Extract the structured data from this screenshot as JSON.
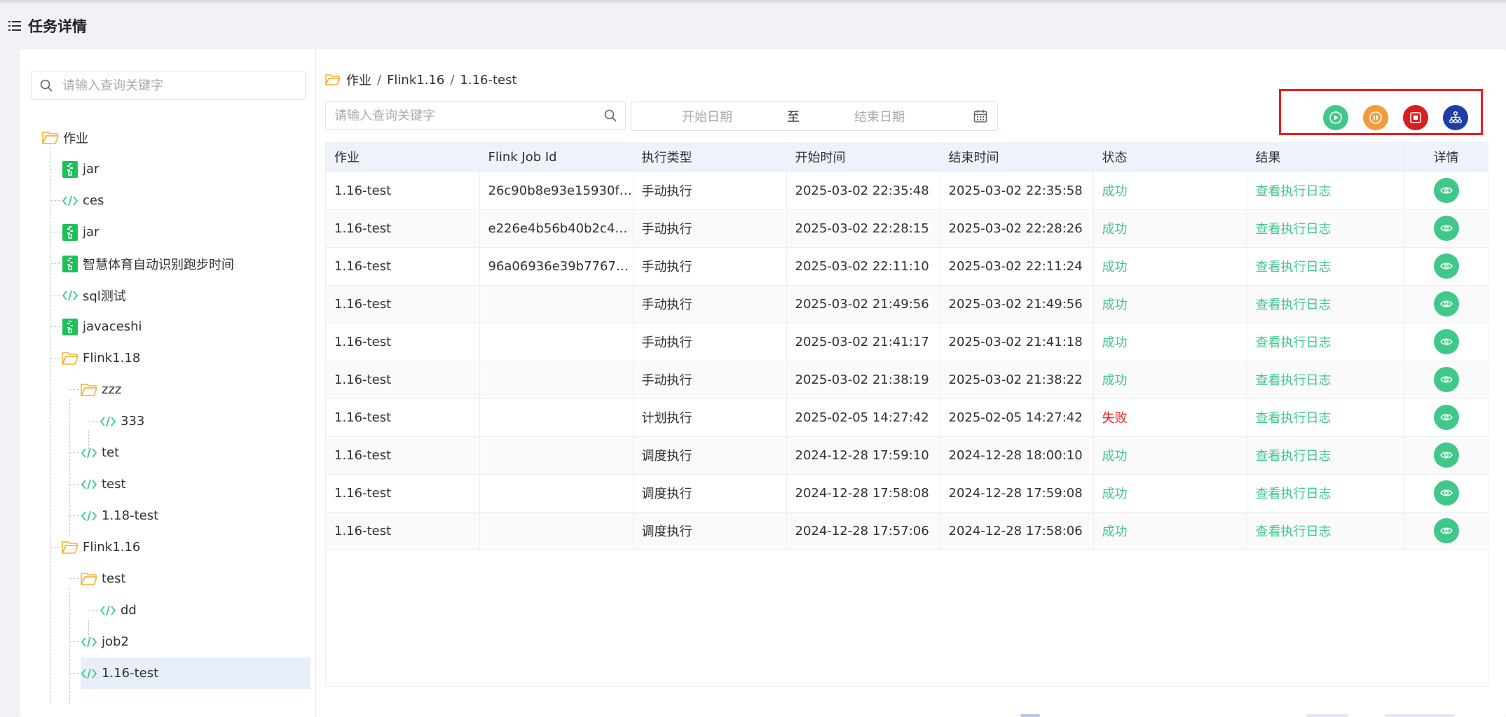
{
  "page": {
    "title": "任务详情"
  },
  "tree": {
    "search_placeholder": "请输入查询关键字",
    "root": "作业",
    "nodes": [
      {
        "label": "jar",
        "icon": "jar-icon"
      },
      {
        "label": "ces",
        "icon": "code-icon"
      },
      {
        "label": "jar",
        "icon": "jar-icon"
      },
      {
        "label": "智慧体育自动识别跑步时间",
        "icon": "jar-icon"
      },
      {
        "label": "sql测试",
        "icon": "code-icon"
      },
      {
        "label": "javaceshi",
        "icon": "jar-icon"
      },
      {
        "label": "Flink1.18",
        "icon": "folder-icon"
      },
      {
        "label": "zzz",
        "icon": "folder-icon"
      },
      {
        "label": "333",
        "icon": "code-icon"
      },
      {
        "label": "tet",
        "icon": "code-icon"
      },
      {
        "label": "test",
        "icon": "code-icon"
      },
      {
        "label": "1.18-test",
        "icon": "code-icon"
      },
      {
        "label": "Flink1.16",
        "icon": "folder-icon"
      },
      {
        "label": "test",
        "icon": "folder-icon"
      },
      {
        "label": "dd",
        "icon": "code-icon"
      },
      {
        "label": "job2",
        "icon": "code-icon"
      },
      {
        "label": "1.16-test",
        "icon": "code-icon"
      }
    ]
  },
  "breadcrumb": {
    "items": [
      "作业",
      "Flink1.16",
      "1.16-test"
    ],
    "separator": "/"
  },
  "filters": {
    "search_placeholder": "请输入查询关键字",
    "start_placeholder": "开始日期",
    "range_separator": "至",
    "end_placeholder": "结束日期"
  },
  "actions": [
    {
      "name": "run-button",
      "icon": "play-icon",
      "color": "#3fc88a"
    },
    {
      "name": "pause-button",
      "icon": "pause-icon",
      "color": "#f29b38"
    },
    {
      "name": "stop-button",
      "icon": "stop-icon",
      "color": "#d81e1e"
    },
    {
      "name": "lineage-button",
      "icon": "sitemap-icon",
      "color": "#1b3fa8"
    }
  ],
  "table": {
    "headers": [
      "作业",
      "Flink Job Id",
      "执行类型",
      "开始时间",
      "结束时间",
      "状态",
      "结果",
      "详情"
    ],
    "rows": [
      {
        "job": "1.16-test",
        "job_id": "26c90b8e93e15930fa…",
        "type": "手动执行",
        "start": "2025-03-02 22:35:48",
        "end": "2025-03-02 22:35:58",
        "status": "成功",
        "result": "查看执行日志"
      },
      {
        "job": "1.16-test",
        "job_id": "e226e4b56b40b2c46…",
        "type": "手动执行",
        "start": "2025-03-02 22:28:15",
        "end": "2025-03-02 22:28:26",
        "status": "成功",
        "result": "查看执行日志"
      },
      {
        "job": "1.16-test",
        "job_id": "96a06936e39b77677…",
        "type": "手动执行",
        "start": "2025-03-02 22:11:10",
        "end": "2025-03-02 22:11:24",
        "status": "成功",
        "result": "查看执行日志"
      },
      {
        "job": "1.16-test",
        "job_id": "",
        "type": "手动执行",
        "start": "2025-03-02 21:49:56",
        "end": "2025-03-02 21:49:56",
        "status": "成功",
        "result": "查看执行日志"
      },
      {
        "job": "1.16-test",
        "job_id": "",
        "type": "手动执行",
        "start": "2025-03-02 21:41:17",
        "end": "2025-03-02 21:41:18",
        "status": "成功",
        "result": "查看执行日志"
      },
      {
        "job": "1.16-test",
        "job_id": "",
        "type": "手动执行",
        "start": "2025-03-02 21:38:19",
        "end": "2025-03-02 21:38:22",
        "status": "成功",
        "result": "查看执行日志"
      },
      {
        "job": "1.16-test",
        "job_id": "",
        "type": "计划执行",
        "start": "2025-02-05 14:27:42",
        "end": "2025-02-05 14:27:42",
        "status": "失败",
        "result": "查看执行日志"
      },
      {
        "job": "1.16-test",
        "job_id": "",
        "type": "调度执行",
        "start": "2024-12-28 17:59:10",
        "end": "2024-12-28 18:00:10",
        "status": "成功",
        "result": "查看执行日志"
      },
      {
        "job": "1.16-test",
        "job_id": "",
        "type": "调度执行",
        "start": "2024-12-28 17:58:08",
        "end": "2024-12-28 17:59:08",
        "status": "成功",
        "result": "查看执行日志"
      },
      {
        "job": "1.16-test",
        "job_id": "",
        "type": "调度执行",
        "start": "2024-12-28 17:57:06",
        "end": "2024-12-28 17:58:06",
        "status": "成功",
        "result": "查看执行日志"
      }
    ]
  },
  "colors": {
    "success": "#3fc88a",
    "fail": "#ee1d1d",
    "accent": "#3fc88a",
    "folder": "#f5b234",
    "highlight": "#ee1d1d"
  }
}
